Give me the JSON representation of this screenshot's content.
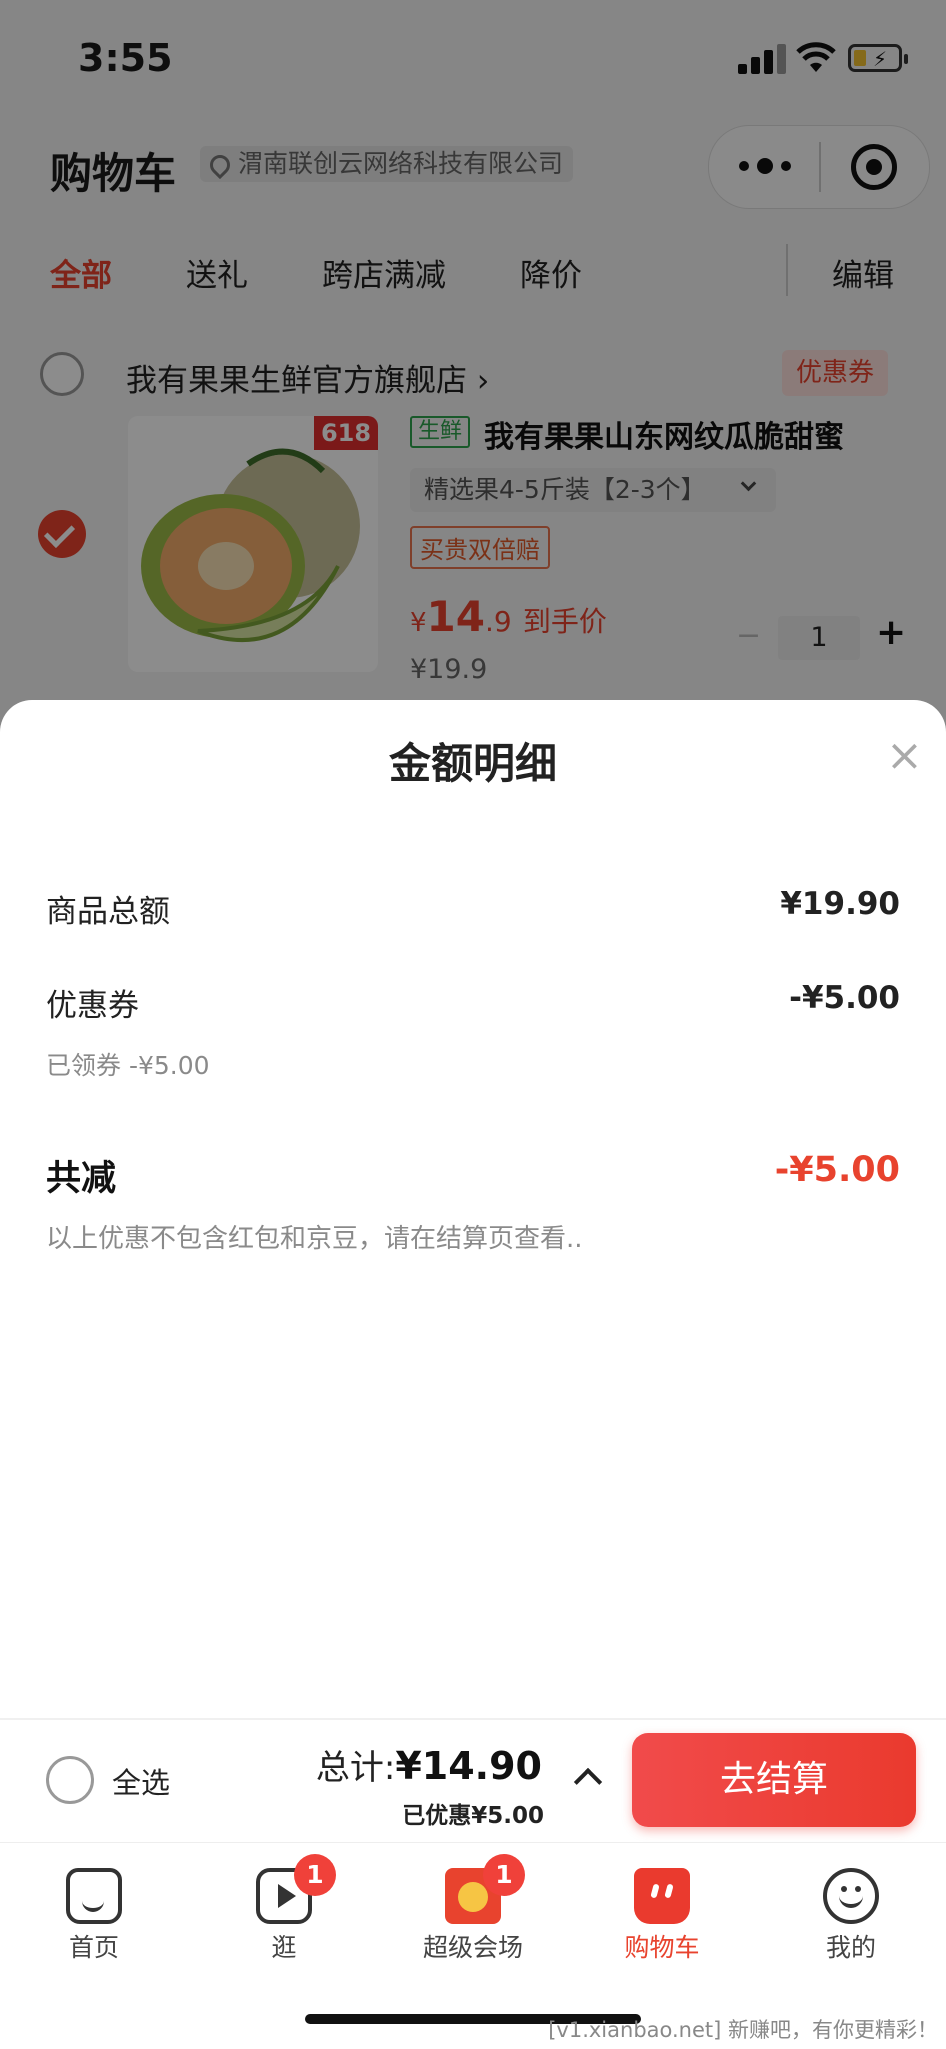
{
  "status_bar": {
    "time": "3:55"
  },
  "header": {
    "title": "购物车",
    "location": "渭南联创云网络科技有限公司"
  },
  "filter_tabs": [
    {
      "label": "全部",
      "active": true
    },
    {
      "label": "送礼"
    },
    {
      "label": "跨店满减"
    },
    {
      "label": "降价"
    }
  ],
  "edit_label": "编辑",
  "store": {
    "name": "我有果果生鲜官方旗舰店",
    "chevron": "›",
    "coupon_label": "优惠券"
  },
  "product": {
    "badge_618": "618",
    "tag": "生鲜",
    "title": "我有果果山东网纹瓜脆甜蜜",
    "spec": "精选果4-5斤装【2-3个】",
    "promo_chip": "买贵双倍赔",
    "price_symbol": "¥",
    "price_int": "14",
    "price_dec": ".9",
    "price_suffix": "到手价",
    "orig_price": "¥19.9",
    "qty": "1",
    "qty_minus": "−",
    "qty_plus": "+"
  },
  "sheet": {
    "title": "金额明细",
    "close": "×",
    "rows": [
      {
        "label": "商品总额",
        "value": "¥19.90"
      },
      {
        "label": "优惠券",
        "value": "-¥5.00",
        "sub": "已领券 -¥5.00"
      }
    ],
    "total": {
      "label": "共减",
      "value": "-¥5.00",
      "note": "以上优惠不包含红包和京豆，请在结算页查看.."
    }
  },
  "summary_bar": {
    "select_all": "全选",
    "total_prefix": "总计:",
    "total": "¥14.90",
    "saved": "已优惠¥5.00",
    "checkout": "去结算"
  },
  "tab_bar": [
    {
      "label": "首页",
      "icon": "home-icon"
    },
    {
      "label": "逛",
      "icon": "video-play-icon",
      "badge": "1"
    },
    {
      "label": "超级会场",
      "icon": "super-venue-icon",
      "badge": "1"
    },
    {
      "label": "购物车",
      "icon": "cart-icon",
      "active": true
    },
    {
      "label": "我的",
      "icon": "profile-icon"
    }
  ],
  "watermark": "[v1.xianbao.net] 新赚吧，有你更精彩！",
  "colors": {
    "accent": "#e8432e",
    "overlay": "rgba(0,0,0,0.45)",
    "checkout_gradient": [
      "#f14b4b",
      "#ea3a2e"
    ]
  }
}
